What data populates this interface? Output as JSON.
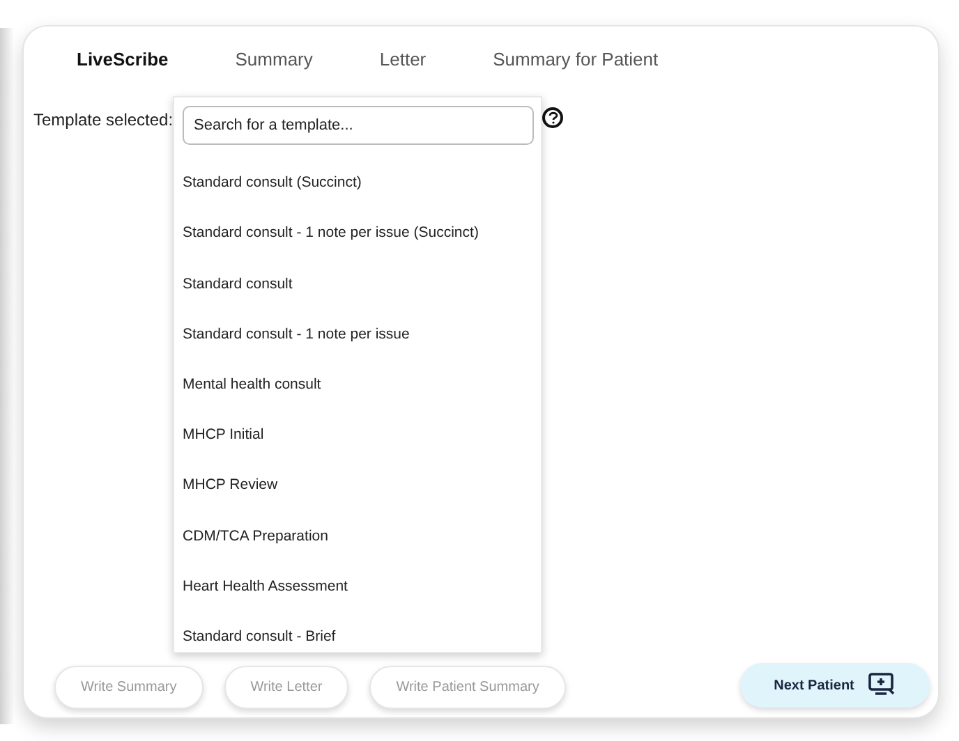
{
  "tabs": [
    {
      "label": "LiveScribe",
      "selected": true
    },
    {
      "label": "Summary",
      "selected": false
    },
    {
      "label": "Letter",
      "selected": false
    },
    {
      "label": "Summary for Patient",
      "selected": false
    }
  ],
  "template": {
    "label": "Template selected:",
    "search": {
      "placeholder": "Search for a template..."
    },
    "options": [
      "Standard consult (Succinct)",
      "Standard consult - 1 note per issue (Succinct)",
      "Standard consult",
      "Standard consult - 1 note per issue",
      "Mental health consult",
      "MHCP Initial",
      "MHCP Review",
      "CDM/TCA Preparation",
      "Heart Health Assessment",
      "Standard consult - Brief"
    ]
  },
  "actions": [
    {
      "label": "Write Summary",
      "disabled": true
    },
    {
      "label": "Write Letter",
      "disabled": true
    },
    {
      "label": "Write Patient Summary",
      "disabled": true
    }
  ],
  "next_button": {
    "label": "Next Patient"
  }
}
